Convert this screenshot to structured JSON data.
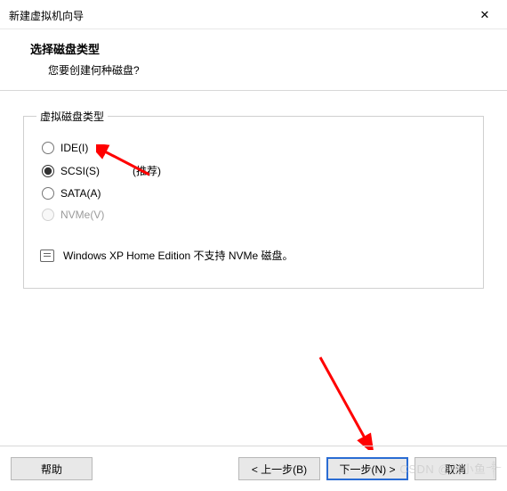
{
  "window": {
    "title": "新建虚拟机向导",
    "close": "✕"
  },
  "header": {
    "title": "选择磁盘类型",
    "subtitle": "您要创建何种磁盘?"
  },
  "group": {
    "legend": "虚拟磁盘类型",
    "options": [
      {
        "label": "IDE(I)",
        "selected": false,
        "disabled": false,
        "hint": ""
      },
      {
        "label": "SCSI(S)",
        "selected": true,
        "disabled": false,
        "hint": "(推荐)"
      },
      {
        "label": "SATA(A)",
        "selected": false,
        "disabled": false,
        "hint": ""
      },
      {
        "label": "NVMe(V)",
        "selected": false,
        "disabled": true,
        "hint": ""
      }
    ],
    "note": "Windows XP Home Edition 不支持 NVMe 磁盘。"
  },
  "footer": {
    "help": "帮助",
    "back": "< 上一步(B)",
    "next": "下一步(N) >",
    "cancel": "取消"
  },
  "watermark": "CSDN @张小鱼༒"
}
